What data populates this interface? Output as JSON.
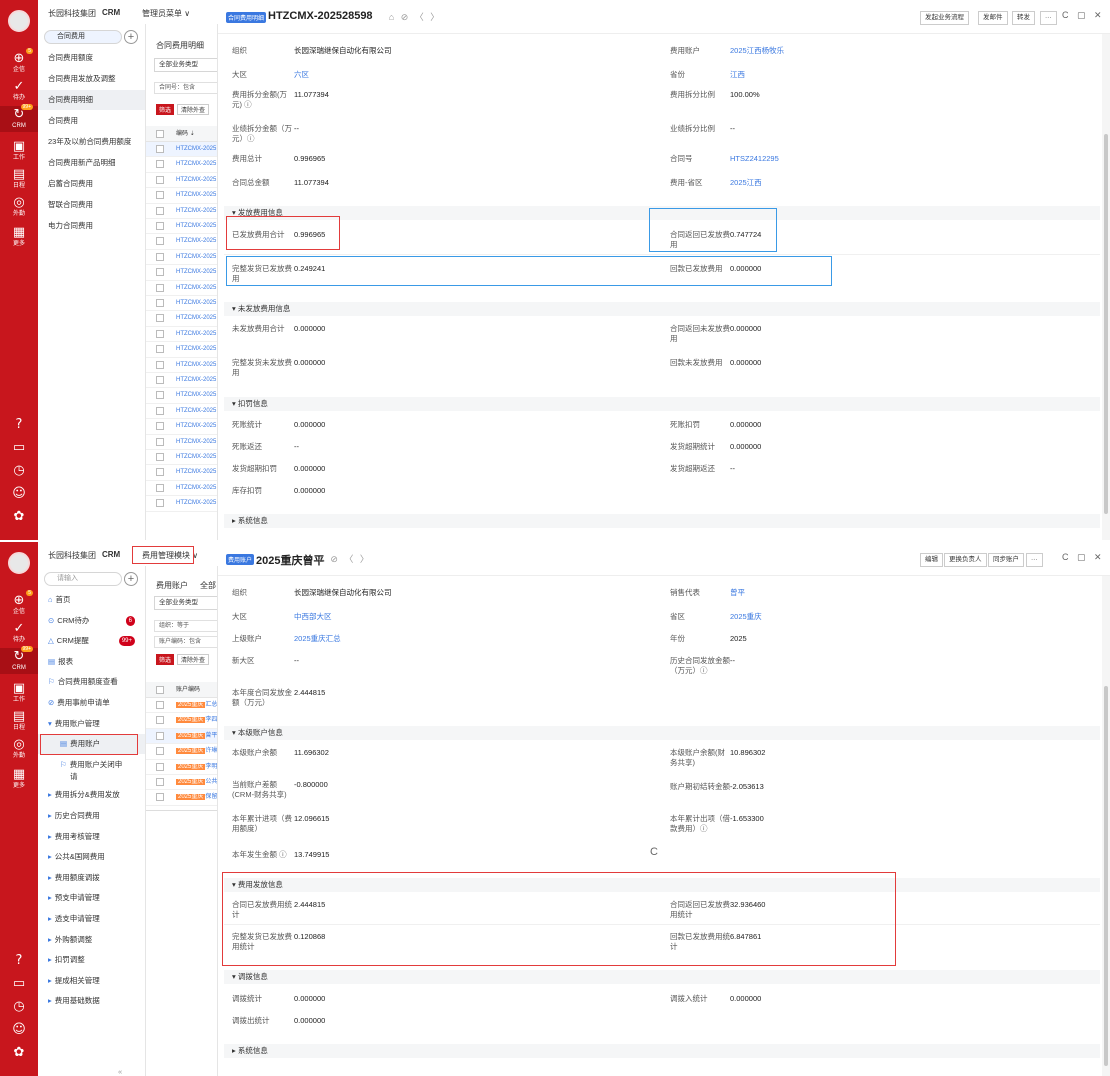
{
  "rail": {
    "items": [
      {
        "glyph": "⊕",
        "label": "企信",
        "badge": "5"
      },
      {
        "glyph": "✓",
        "label": "待办"
      },
      {
        "glyph": "↻",
        "label": "CRM",
        "badge": "99+"
      },
      {
        "glyph": "▣",
        "label": "工作"
      },
      {
        "glyph": "▤",
        "label": "日程"
      },
      {
        "glyph": "◎",
        "label": "外勤"
      },
      {
        "glyph": "▦",
        "label": "更多"
      }
    ],
    "bottom": [
      "?",
      "▭",
      "◷",
      "☺",
      "✿"
    ]
  },
  "screen1": {
    "breadcrumb": {
      "org": "长园科技集团",
      "app": "CRM",
      "menu": "管理员菜单 ∨"
    },
    "menu": {
      "search": "合同费用",
      "items": [
        "合同费用额度",
        "合同费用发放及调整",
        "合同费用明细",
        "合同费用",
        "23年及以前合同费用额度",
        "合同费用新产品明细",
        "启蓄合同费用",
        "智联合同费用",
        "电力合同费用"
      ],
      "selected_index": 2
    },
    "list": {
      "title": "合同费用明细",
      "type_select": "全部业务类型",
      "filter": "合同号：包含",
      "filter_btn": "筛选",
      "clear_btn": "清除外查",
      "header": "编码 ⇣",
      "row_text": "HTZCMX-2025",
      "row_count": 24
    },
    "detail": {
      "type_tag": "合同费用明细",
      "title": "HTZCMX-202528598",
      "buttons": [
        "发起业务流程",
        "发邮件",
        "转发",
        "···"
      ],
      "fields_top": [
        {
          "l": "组织",
          "v": "长园深瑞继保自动化有限公司"
        },
        {
          "l": "费用账户",
          "v": "2025江西杨牧乐",
          "link": true
        },
        {
          "l": "大区",
          "v": "六区",
          "link": true
        },
        {
          "l": "省份",
          "v": "江西",
          "link": true
        },
        {
          "l": "费用拆分金额(万",
          "l2": "元) ⓘ",
          "v": "11.077394"
        },
        {
          "l": "费用拆分比例",
          "v": "100.00%"
        },
        {
          "l": "业绩拆分金额（万",
          "l2": "元）ⓘ",
          "v": "--"
        },
        {
          "l": "业绩拆分比例",
          "v": "--"
        },
        {
          "l": "费用总计",
          "v": "0.996965"
        },
        {
          "l": "合同号",
          "v": "HTSZ2412295",
          "link": true
        },
        {
          "l": "合同总金额",
          "v": "11.077394"
        },
        {
          "l": "费用-省区",
          "v": "2025江西",
          "link": true
        }
      ],
      "sec_issued": "▾  发放费用信息",
      "issued": [
        {
          "l": "已发放费用合计",
          "v": "0.996965"
        },
        {
          "l": "合同返回已发放费",
          "l2": "用",
          "v": "0.747724"
        },
        {
          "l": "完整发货已发放费",
          "l2": "用",
          "v": "0.249241"
        },
        {
          "l": "回款已发放费用",
          "v": "0.000000"
        }
      ],
      "sec_unissued": "▾  未发放费用信息",
      "unissued": [
        {
          "l": "未发放费用合计",
          "v": "0.000000"
        },
        {
          "l": "合同返回未发放费",
          "l2": "用",
          "v": "0.000000"
        },
        {
          "l": "完整发货未发放费",
          "l2": "用",
          "v": "0.000000"
        },
        {
          "l": "回款未发放费用",
          "v": "0.000000"
        }
      ],
      "sec_penalty": "▾  扣罚信息",
      "penalty": [
        {
          "l": "死账统计",
          "v": "0.000000"
        },
        {
          "l": "死账扣罚",
          "v": "0.000000"
        },
        {
          "l": "死账返还",
          "v": "--"
        },
        {
          "l": "发货超期统计",
          "v": "0.000000"
        },
        {
          "l": "发货超期扣罚",
          "v": "0.000000"
        },
        {
          "l": "发货超期返还",
          "v": "--"
        },
        {
          "l": "库存扣罚",
          "v": "0.000000"
        }
      ],
      "sec_system": "▸  系统信息"
    }
  },
  "screen2": {
    "breadcrumb": {
      "org": "长园科技集团",
      "app": "CRM",
      "menu": "费用管理模块 ∨"
    },
    "menu": {
      "search": "请输入",
      "items": [
        {
          "icon": "⌂",
          "label": "首页"
        },
        {
          "icon": "⊙",
          "label": "CRM待办",
          "badge": "6"
        },
        {
          "icon": "△",
          "label": "CRM提醒",
          "badge": "99+"
        },
        {
          "icon": "▤",
          "label": "报表"
        },
        {
          "icon": "⚐",
          "label": "合同费用额度查看"
        },
        {
          "icon": "⊘",
          "label": "费用事前申请单"
        },
        {
          "icon": "▾",
          "label": "费用账户管理"
        },
        {
          "icon": "▤",
          "label": "费用账户",
          "sub": true
        },
        {
          "icon": "⚐",
          "label": "费用账户关闭申",
          "sub": true,
          "line2": "请"
        },
        {
          "icon": "▸",
          "label": "费用拆分&费用发放"
        },
        {
          "icon": "▸",
          "label": "历史合同费用"
        },
        {
          "icon": "▸",
          "label": "费用考核管理"
        },
        {
          "icon": "▸",
          "label": "公共&国网费用"
        },
        {
          "icon": "▸",
          "label": "费用额度调拨"
        },
        {
          "icon": "▸",
          "label": "预支申请管理"
        },
        {
          "icon": "▸",
          "label": "透支申请管理"
        },
        {
          "icon": "▸",
          "label": "外购额调整"
        },
        {
          "icon": "▸",
          "label": "扣罚调整"
        },
        {
          "icon": "▸",
          "label": "提成相关管理"
        },
        {
          "icon": "▸",
          "label": "费用基础数据"
        }
      ],
      "collapse": "«"
    },
    "list": {
      "title": "费用账户",
      "title_right": "全部",
      "type_select": "全部业务类型",
      "filter1": "组织：等于",
      "filter2": "账户编码：包含",
      "filter_btn": "筛选",
      "clear_btn": "清除外查",
      "header": "账户编码",
      "rows": [
        {
          "tag": "2025重庆",
          "rest": "汇总"
        },
        {
          "tag": "2025重庆",
          "rest": "李四"
        },
        {
          "tag": "2025重庆",
          "rest": "曾平"
        },
        {
          "tag": "2025重庆",
          "rest": "许琳"
        },
        {
          "tag": "2025重庆",
          "rest": "李明"
        },
        {
          "tag": "2025重庆",
          "rest": "公共"
        },
        {
          "tag": "2025重庆",
          "rest": "保留"
        }
      ]
    },
    "detail": {
      "type_tag": "费用账户",
      "title": "2025重庆曾平",
      "buttons": [
        "编辑",
        "更换负责人",
        "同步账户",
        "···"
      ],
      "fields_top": [
        {
          "l": "组织",
          "v": "长园深瑞继保自动化有限公司"
        },
        {
          "l": "销售代表",
          "v": "曾平",
          "link": true
        },
        {
          "l": "大区",
          "v": "中西部大区",
          "link": true
        },
        {
          "l": "省区",
          "v": "2025重庆",
          "link": true
        },
        {
          "l": "上级账户",
          "v": "2025重庆汇总",
          "link": true
        },
        {
          "l": "年份",
          "v": "2025"
        },
        {
          "l": "新大区",
          "v": "--"
        },
        {
          "l": "历史合同发放金额",
          "l2": "（万元）ⓘ",
          "v": "--"
        },
        {
          "l": "本年度合同发放金",
          "l2": "额（万元）",
          "v": "2.444815"
        }
      ],
      "sec_account": "▾  本级账户信息",
      "account": [
        {
          "l": "本级账户余额",
          "v": "11.696302"
        },
        {
          "l": "本级账户余额(财",
          "l2": "务共享)",
          "v": "10.896302"
        },
        {
          "l": "当前账户差额",
          "l2": "(CRM-财务共享)",
          "v": "-0.800000"
        },
        {
          "l": "账户期初结转金额",
          "v": "-2.053613"
        },
        {
          "l": "本年累计进项（费",
          "l2": "用额度）",
          "v": "12.096615"
        },
        {
          "l": "本年累计出项（借",
          "l2": "款费用）ⓘ",
          "v": "-1.653300"
        },
        {
          "l": "本年发生金额 ⓘ",
          "v": "13.749915"
        }
      ],
      "sec_issue": "▾  费用发放信息",
      "issue": [
        {
          "l": "合同已发放费用统",
          "l2": "计",
          "v": "2.444815"
        },
        {
          "l": "合同返回已发放费",
          "l2": "用统计",
          "v": "32.936460"
        },
        {
          "l": "完整发货已发放费",
          "l2": "用统计",
          "v": "0.120868"
        },
        {
          "l": "回款已发放费用统",
          "l2": "计",
          "v": "6.847861"
        }
      ],
      "sec_transfer": "▾  调拨信息",
      "transfer": [
        {
          "l": "调拨统计",
          "v": "0.000000"
        },
        {
          "l": "调拨入统计",
          "v": "0.000000"
        },
        {
          "l": "调拨出统计",
          "v": "0.000000"
        }
      ],
      "sec_system": "▸  系统信息"
    }
  },
  "common": {
    "tools": "⌂ ⊘ 〈 〉",
    "window": "C ▢ ✕",
    "refresh": "C"
  }
}
